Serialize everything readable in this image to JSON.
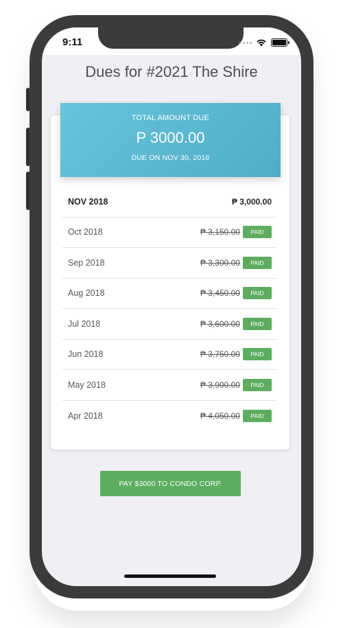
{
  "status_bar": {
    "time": "9:11",
    "icons": [
      "signal-icon",
      "wifi-icon",
      "battery-icon"
    ]
  },
  "page": {
    "title": "Dues for #2021 The Shire"
  },
  "summary": {
    "label": "TOTAL AMOUNT DUE",
    "amount": "P 3000.00",
    "due_date": "DUE ON NOV 30, 2018"
  },
  "dues": [
    {
      "month": "NOV 2018",
      "amount": "₱ 3,000.00",
      "status": "current"
    },
    {
      "month": "Oct 2018",
      "amount": "₱ 3,150.00",
      "status": "PAID"
    },
    {
      "month": "Sep 2018",
      "amount": "₱ 3,300.00",
      "status": "PAID"
    },
    {
      "month": "Aug 2018",
      "amount": "₱ 3,450.00",
      "status": "PAID"
    },
    {
      "month": "Jul 2018",
      "amount": "₱ 3,600.00",
      "status": "PAID"
    },
    {
      "month": "Jun 2018",
      "amount": "₱ 3,750.00",
      "status": "PAID"
    },
    {
      "month": "May 2018",
      "amount": "₱ 3,900.00",
      "status": "PAID"
    },
    {
      "month": "Apr 2018",
      "amount": "₱ 4,050.00",
      "status": "PAID"
    }
  ],
  "actions": {
    "pay_label": "PAY $3000 TO CONDO CORP."
  },
  "colors": {
    "hero_gradient_start": "#66c4dc",
    "hero_gradient_end": "#4fadc6",
    "paid_green": "#5cae5e",
    "background": "#efeff4"
  }
}
